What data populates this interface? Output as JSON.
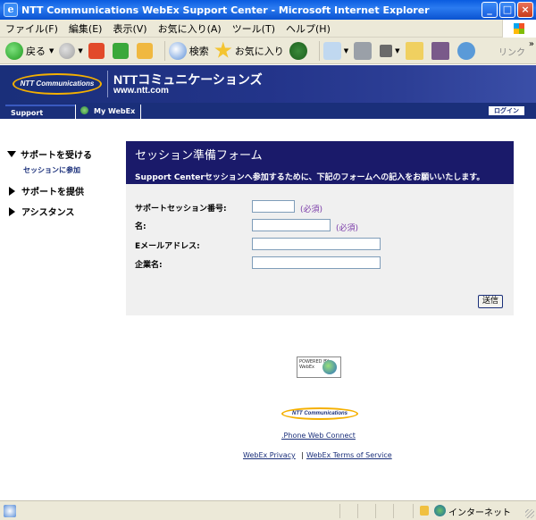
{
  "window": {
    "title": "NTT Communications WebEx Support Center - Microsoft Internet Explorer",
    "buttons": {
      "minimize": "_",
      "maximize": "□",
      "close": "×"
    }
  },
  "menubar": {
    "items": [
      "ファイル(F)",
      "編集(E)",
      "表示(V)",
      "お気に入り(A)",
      "ツール(T)",
      "ヘルプ(H)"
    ]
  },
  "toolbar": {
    "back_label": "戻る",
    "search_label": "検索",
    "favorites_label": "お気に入り",
    "links_label": "リンク",
    "chevron": "»"
  },
  "banner": {
    "logo_text": "NTT Communications",
    "company_name": "NTTコミュニケーションズ",
    "url": "www.ntt.com"
  },
  "navbar": {
    "tab_support_center": "Support Center",
    "tab_my_webex": "My WebEx",
    "login_label": "ログイン"
  },
  "sidebar": {
    "item1": "サポートを受ける",
    "item1_sub": "セッションに参加",
    "item2": "サポートを提供",
    "item3": "アシスタンス"
  },
  "form": {
    "title": "セッション準備フォーム",
    "description": "Support Centerセッションへ参加するために、下記のフォームへの記入をお願いいたします。",
    "session_number_label": "サポートセッション番号:",
    "name_label": "名:",
    "email_label": "Eメールアドレス:",
    "company_label": "企業名:",
    "required_label": "(必須)",
    "session_number_value": "",
    "name_value": "",
    "email_value": "",
    "company_value": "",
    "submit_label": "送信"
  },
  "footer": {
    "powered_by": "POWERED BY WebEx",
    "logo_text": "NTT Communications",
    "phone_link": ".Phone Web Connect",
    "privacy_link": "WebEx Privacy",
    "separator": "|",
    "terms_link": "WebEx Terms of Service"
  },
  "statusbar": {
    "zone_label": "インターネット"
  }
}
